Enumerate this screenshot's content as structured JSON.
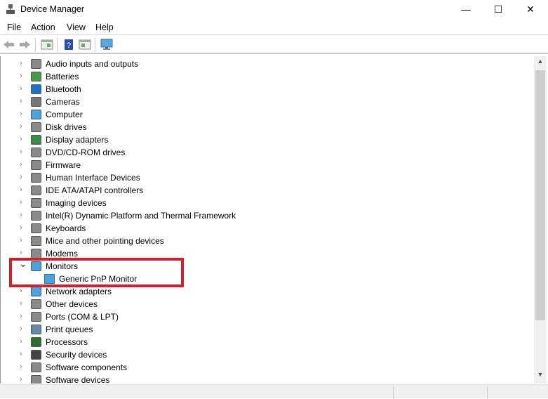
{
  "window": {
    "title": "Device Manager",
    "minimize": "—",
    "maximize": "☐",
    "close": "✕"
  },
  "menu": [
    "File",
    "Action",
    "View",
    "Help"
  ],
  "toolbar": {
    "icons": [
      "back-icon",
      "forward-icon",
      "show-hide-console-tree-icon",
      "help-icon",
      "action-pane-icon",
      "scan-hardware-icon"
    ]
  },
  "tree": [
    {
      "label": "Audio inputs and outputs",
      "icon": "speaker-icon",
      "expanded": false
    },
    {
      "label": "Batteries",
      "icon": "battery-icon",
      "expanded": false
    },
    {
      "label": "Bluetooth",
      "icon": "bluetooth-icon",
      "expanded": false
    },
    {
      "label": "Cameras",
      "icon": "camera-icon",
      "expanded": false
    },
    {
      "label": "Computer",
      "icon": "computer-icon",
      "expanded": false
    },
    {
      "label": "Disk drives",
      "icon": "disk-drive-icon",
      "expanded": false
    },
    {
      "label": "Display adapters",
      "icon": "display-adapter-icon",
      "expanded": false
    },
    {
      "label": "DVD/CD-ROM drives",
      "icon": "dvd-icon",
      "expanded": false
    },
    {
      "label": "Firmware",
      "icon": "firmware-icon",
      "expanded": false
    },
    {
      "label": "Human Interface Devices",
      "icon": "hid-icon",
      "expanded": false
    },
    {
      "label": "IDE ATA/ATAPI controllers",
      "icon": "ide-icon",
      "expanded": false
    },
    {
      "label": "Imaging devices",
      "icon": "imaging-icon",
      "expanded": false
    },
    {
      "label": "Intel(R) Dynamic Platform and Thermal Framework",
      "icon": "chip-icon",
      "expanded": false
    },
    {
      "label": "Keyboards",
      "icon": "keyboard-icon",
      "expanded": false
    },
    {
      "label": "Mice and other pointing devices",
      "icon": "mouse-icon",
      "expanded": false
    },
    {
      "label": "Modems",
      "icon": "modem-icon",
      "expanded": false
    },
    {
      "label": "Monitors",
      "icon": "monitor-icon",
      "expanded": true,
      "children": [
        "Generic PnP Monitor"
      ]
    },
    {
      "label": "Network adapters",
      "icon": "network-icon",
      "expanded": false
    },
    {
      "label": "Other devices",
      "icon": "unknown-device-icon",
      "expanded": false
    },
    {
      "label": "Ports (COM & LPT)",
      "icon": "port-icon",
      "expanded": false
    },
    {
      "label": "Print queues",
      "icon": "printer-icon",
      "expanded": false
    },
    {
      "label": "Processors",
      "icon": "processor-icon",
      "expanded": false
    },
    {
      "label": "Security devices",
      "icon": "security-icon",
      "expanded": false
    },
    {
      "label": "Software components",
      "icon": "software-component-icon",
      "expanded": false
    },
    {
      "label": "Software devices",
      "icon": "software-device-icon",
      "expanded": false
    }
  ],
  "highlight_color": "#d0202e"
}
